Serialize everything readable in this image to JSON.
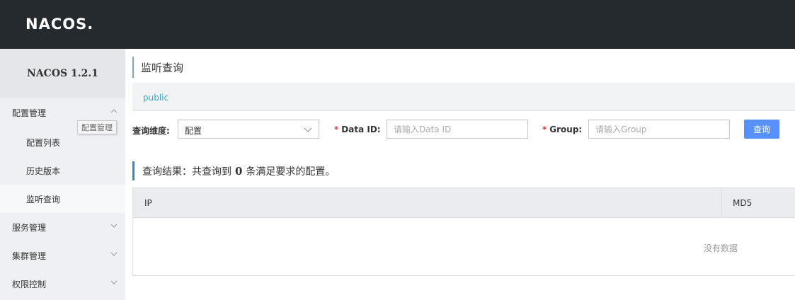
{
  "header": {
    "logo_text": "NACOS."
  },
  "sidebar": {
    "version": "NACOS 1.2.1",
    "items": [
      {
        "label": "配置管理",
        "expanded": true
      },
      {
        "label": "配置列表"
      },
      {
        "label": "历史版本"
      },
      {
        "label": "监听查询",
        "active": true
      },
      {
        "label": "服务管理"
      },
      {
        "label": "集群管理"
      },
      {
        "label": "权限控制"
      }
    ],
    "tooltip": "配置管理"
  },
  "main": {
    "title": "监听查询",
    "namespace": "public",
    "form": {
      "dimension_label": "查询维度:",
      "dimension_value": "配置",
      "dataid_label": "Data ID:",
      "dataid_placeholder": "请输入Data ID",
      "group_label": "Group:",
      "group_placeholder": "请输入Group",
      "query_button": "查询"
    },
    "result": {
      "prefix": "查询结果：共查询到",
      "count": "0",
      "suffix": "条满足要求的配置。"
    },
    "table": {
      "columns": [
        "IP",
        "MD5"
      ],
      "empty_text": "没有数据"
    }
  },
  "colors": {
    "header_bg": "#252a2f",
    "accent": "#5791f9",
    "link": "#2eaadc"
  }
}
